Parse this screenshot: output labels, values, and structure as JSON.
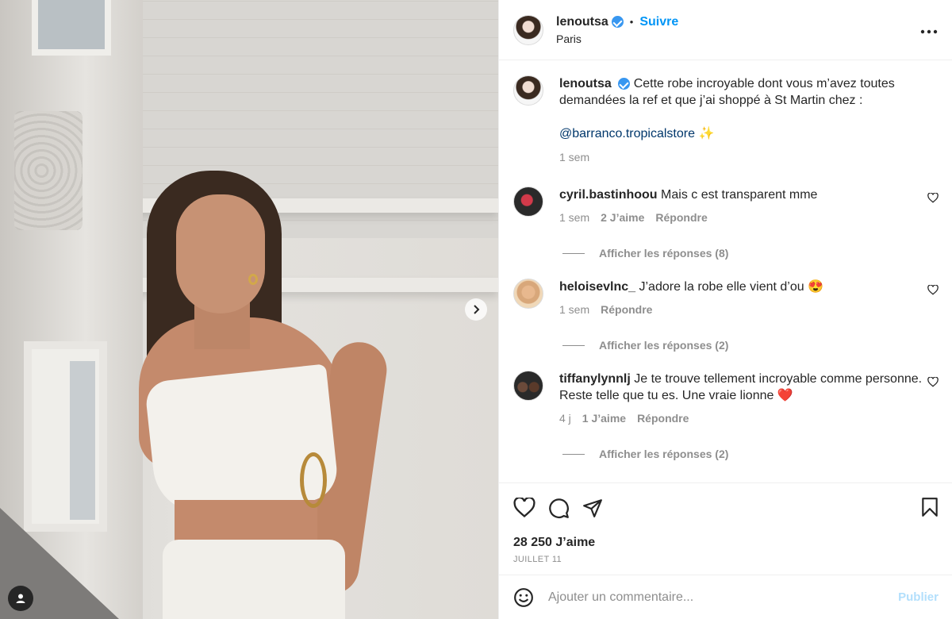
{
  "post": {
    "username": "lenoutsa",
    "follow_label": "Suivre",
    "location": "Paris",
    "caption_line1": "Cette robe incroyable dont vous m’avez toutes demandées la ref et que j’ai shoppé à St Martin chez :",
    "mention": "@barranco.tropicalstore",
    "mention_emoji": "✨",
    "caption_time": "1 sem"
  },
  "comments": [
    {
      "user": "cyril.bastinhoou",
      "text": "Mais c est transparent mme",
      "time": "1 sem",
      "likes": "2 J’aime",
      "reply": "Répondre",
      "replies": "Afficher les réponses (8)"
    },
    {
      "user": "heloisevlnc_",
      "text": "J’adore la robe elle vient d’ou 😍",
      "time": "1 sem",
      "likes": "",
      "reply": "Répondre",
      "replies": "Afficher les réponses (2)"
    },
    {
      "user": "tiffanylynnlj",
      "text": "Je te trouve tellement incroyable comme personne. Reste telle que tu es. Une vraie lionne ❤️",
      "time": "4 j",
      "likes": "1 J’aime",
      "reply": "Répondre",
      "replies": "Afficher les réponses (2)"
    }
  ],
  "stats": {
    "likes": "28 250 J’aime",
    "date": "JUILLET 11"
  },
  "composer": {
    "placeholder": "Ajouter un commentaire...",
    "publish_label": "Publier"
  },
  "colors": {
    "accent": "#0095f6",
    "mention": "#00376b",
    "muted": "#8e8e8e",
    "verified": "#3897f0"
  },
  "icons": [
    "chevron-right-icon",
    "user-tag-icon",
    "more-icon",
    "verified-icon",
    "heart-icon",
    "comment-icon",
    "share-icon",
    "bookmark-icon",
    "emoji-icon"
  ]
}
